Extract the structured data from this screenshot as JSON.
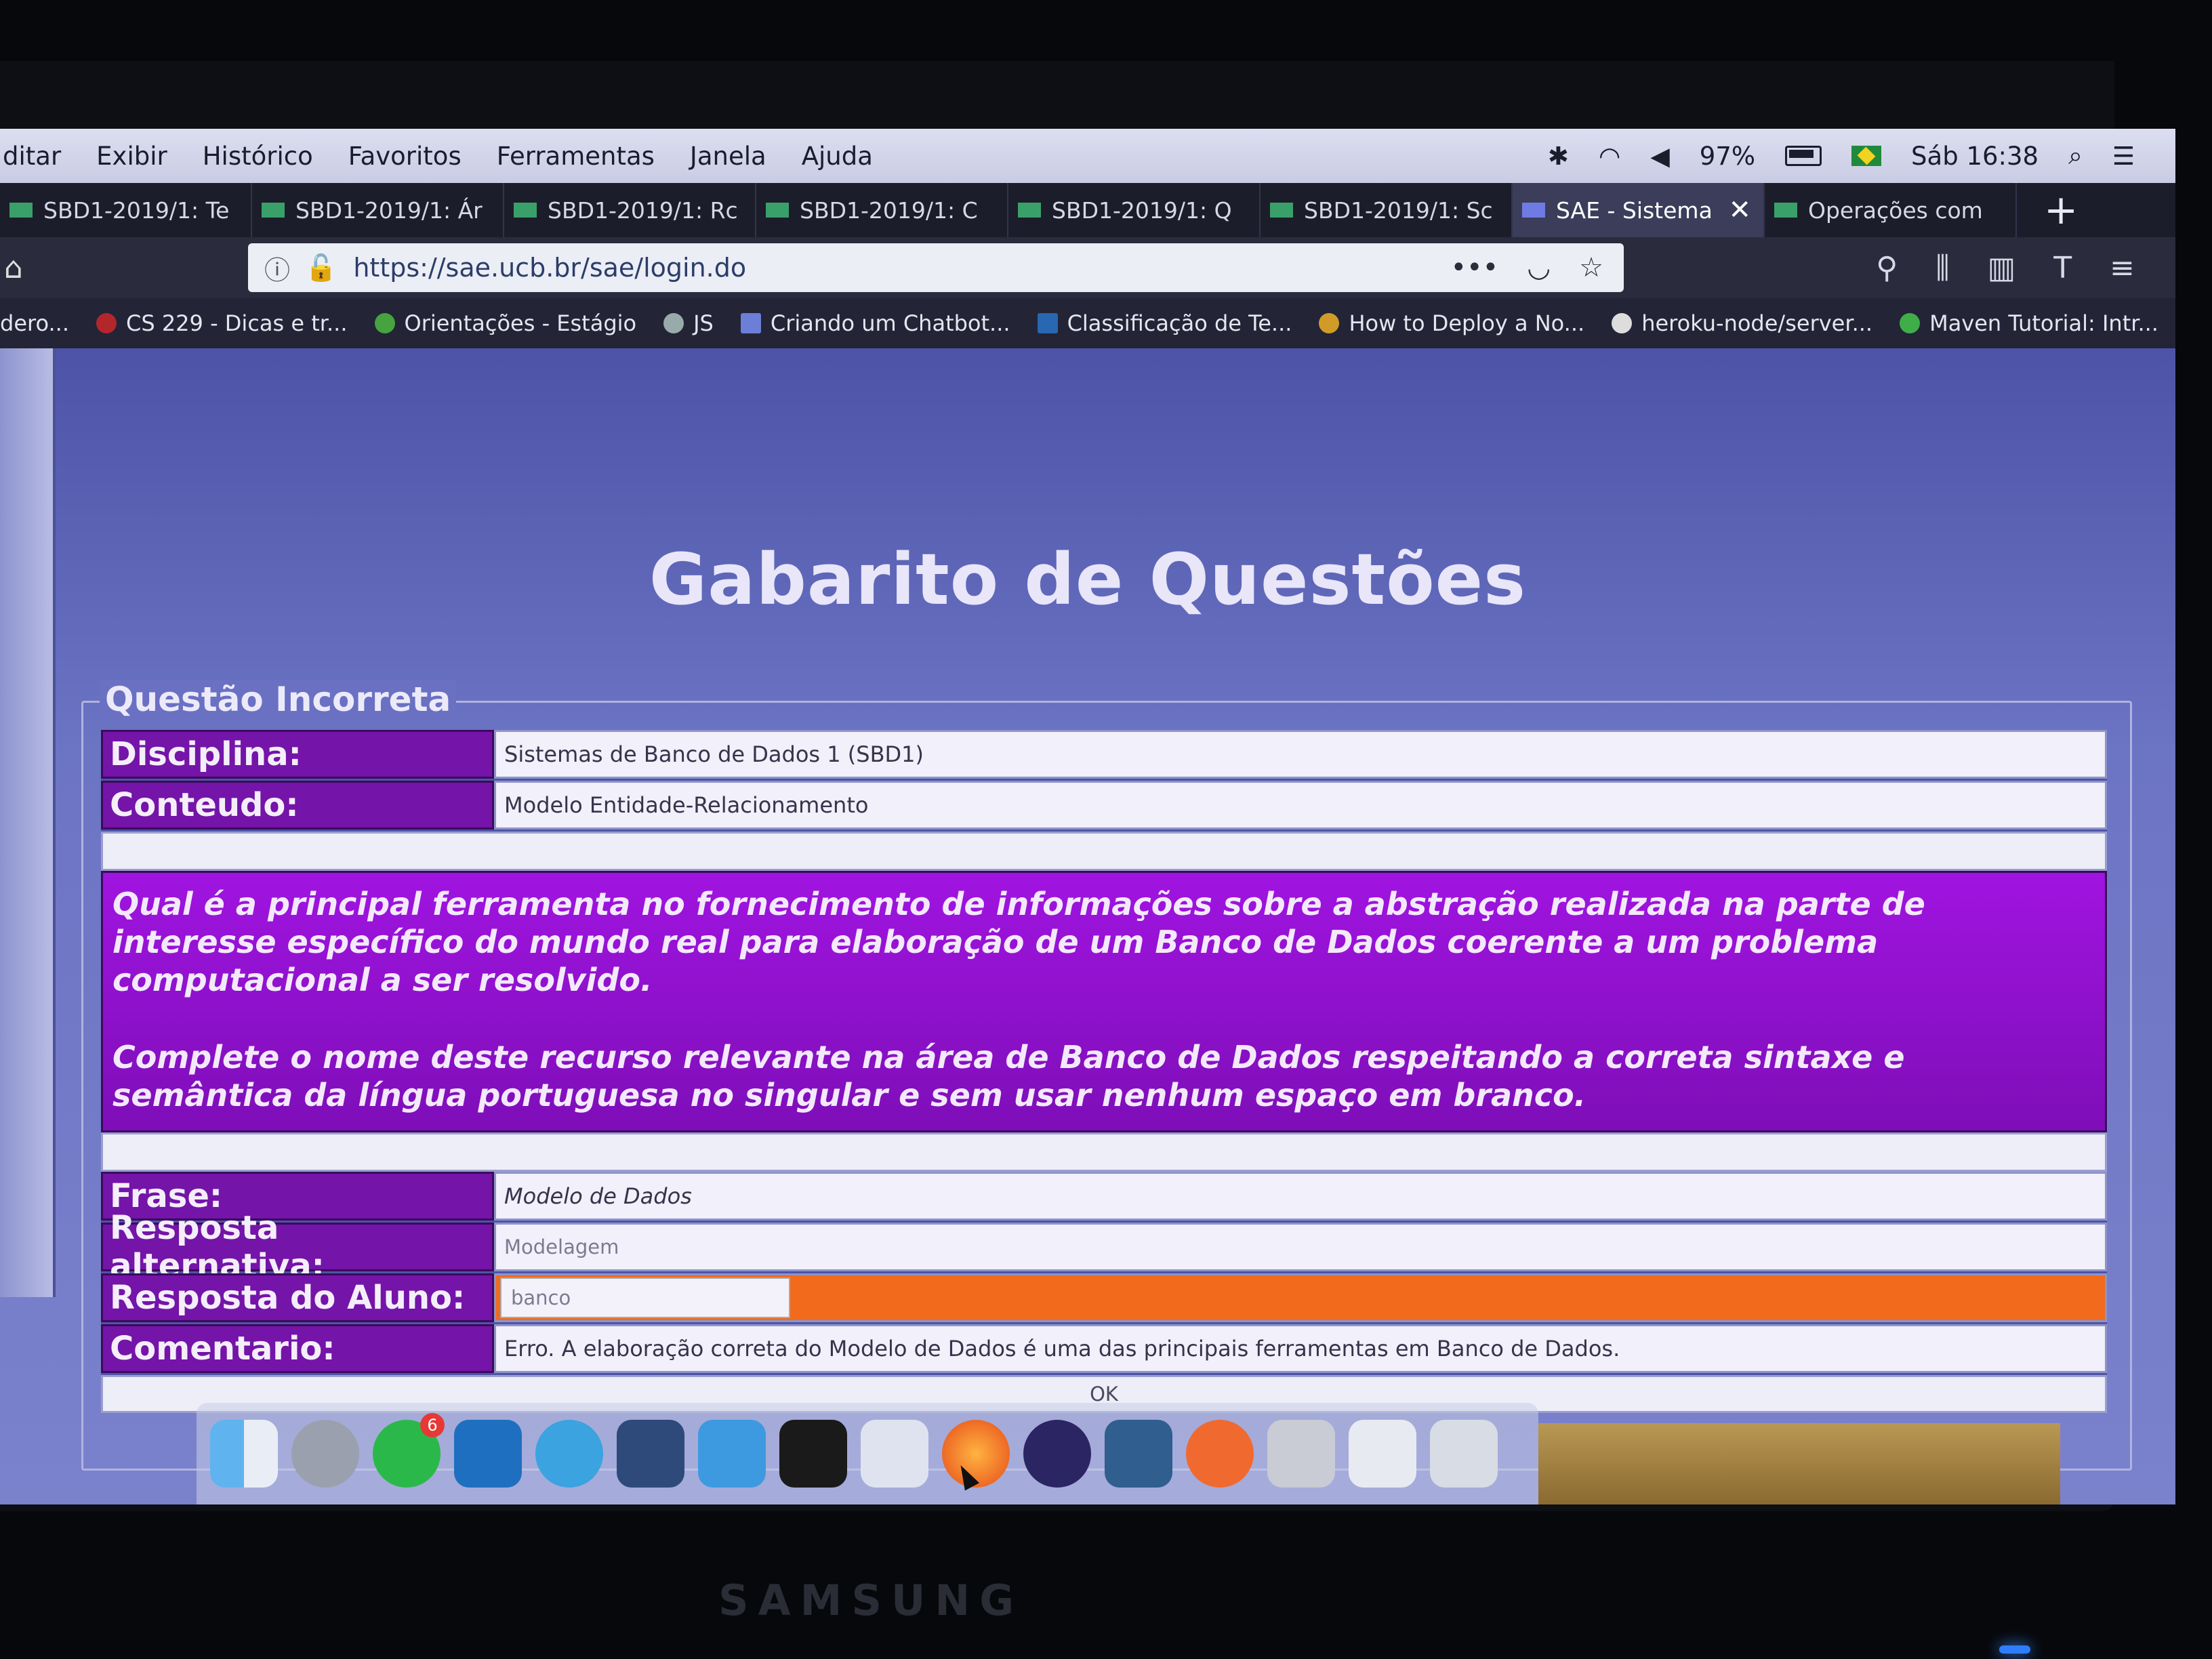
{
  "menubar": {
    "menus": [
      "ditar",
      "Exibir",
      "Histórico",
      "Favoritos",
      "Ferramentas",
      "Janela",
      "Ajuda"
    ],
    "battery": "97%",
    "clock": "Sáb 16:38"
  },
  "tabs": [
    {
      "label": "SBD1-2019/1: Te"
    },
    {
      "label": "SBD1-2019/1: Ár"
    },
    {
      "label": "SBD1-2019/1: Rc"
    },
    {
      "label": "SBD1-2019/1: C"
    },
    {
      "label": "SBD1-2019/1: Q"
    },
    {
      "label": "SBD1-2019/1: Sc"
    },
    {
      "label": "SAE - Sistema",
      "active": true
    },
    {
      "label": "Operações com"
    }
  ],
  "urlbar": {
    "url": "https://sae.ucb.br/sae/login.do"
  },
  "bookmarks": [
    "dero...",
    "CS 229 - Dicas e tr...",
    "Orientações - Estágio",
    "JS",
    "Criando um Chatbot...",
    "Classificação de Te...",
    "How to Deploy a No...",
    "heroku-node/server...",
    "Maven Tutorial: Intr..."
  ],
  "page": {
    "title": "Gabarito de Questões",
    "legend": "Questão Incorreta",
    "disciplina_label": "Disciplina:",
    "disciplina_value": "Sistemas de Banco de Dados 1 (SBD1)",
    "conteudo_label": "Conteudo:",
    "conteudo_value": "Modelo Entidade-Relacionamento",
    "question_p1": "Qual é a principal ferramenta no fornecimento de informações sobre a abstração realizada na parte de interesse específico do mundo real para elaboração de um Banco de Dados coerente a um problema computacional a ser resolvido.",
    "question_p2": "Complete o nome deste recurso relevante na área de Banco de Dados respeitando a correta sintaxe e semântica da língua portuguesa no singular e sem usar nenhum espaço em branco.",
    "frase_label": "Frase:",
    "frase_value": "Modelo de Dados",
    "alt_label": "Resposta alternativa:",
    "alt_value": "Modelagem",
    "aluno_label": "Resposta do Aluno:",
    "aluno_value": "banco",
    "comentario_label": "Comentario:",
    "comentario_value": "Erro. A elaboração correta do Modelo de Dados é uma das principais ferramentas em Banco de Dados.",
    "ok_label": "OK"
  },
  "dock": {
    "whatsapp_badge": "6"
  },
  "monitor_brand": "SAMSUNG",
  "colors": {
    "label_bg": "#7414a8",
    "question_bg": "#a014e0",
    "wrong_answer_bg": "#f26a1b",
    "page_bg": "#6c74c4"
  }
}
